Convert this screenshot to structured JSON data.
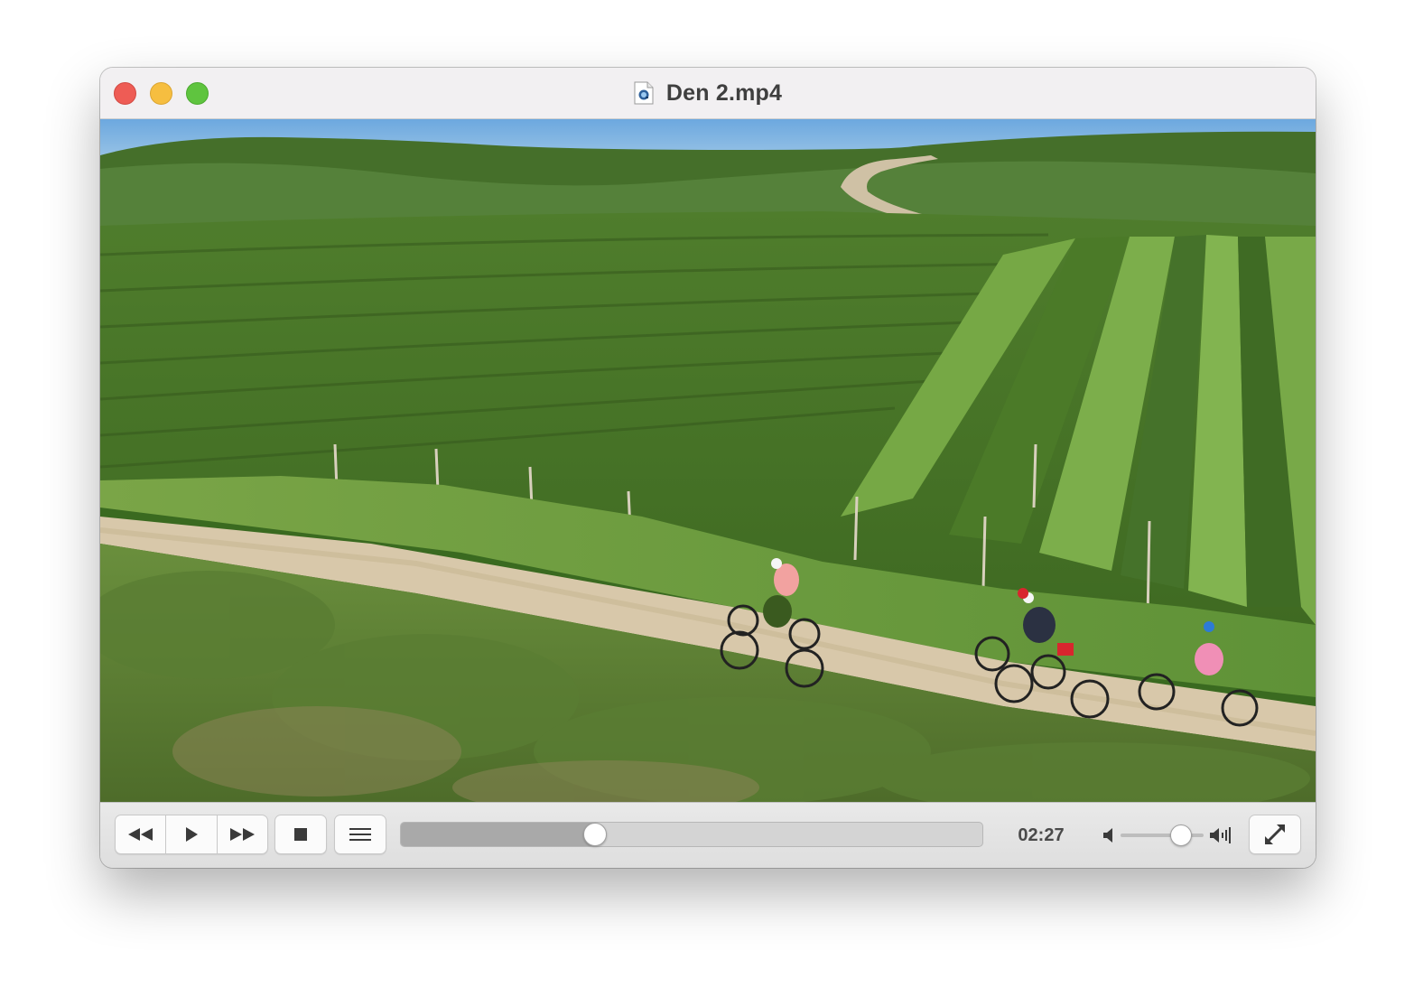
{
  "window": {
    "title": "Den 2.mp4",
    "file_icon": "quicktime-file-icon",
    "traffic_lights": {
      "close": "#ee5c55",
      "minimize": "#f6be40",
      "zoom": "#5fc43f"
    }
  },
  "video": {
    "content": "video-frame"
  },
  "controls": {
    "rewind_icon": "rewind-icon",
    "play_icon": "play-icon",
    "fast_forward_icon": "fast-forward-icon",
    "stop_icon": "stop-icon",
    "playlist_icon": "playlist-icon",
    "progress": 0.335,
    "time": "02:27",
    "volume_low_icon": "speaker-low-icon",
    "volume_high_icon": "speaker-high-icon",
    "volume": 0.73,
    "fullscreen_icon": "fullscreen-icon"
  }
}
